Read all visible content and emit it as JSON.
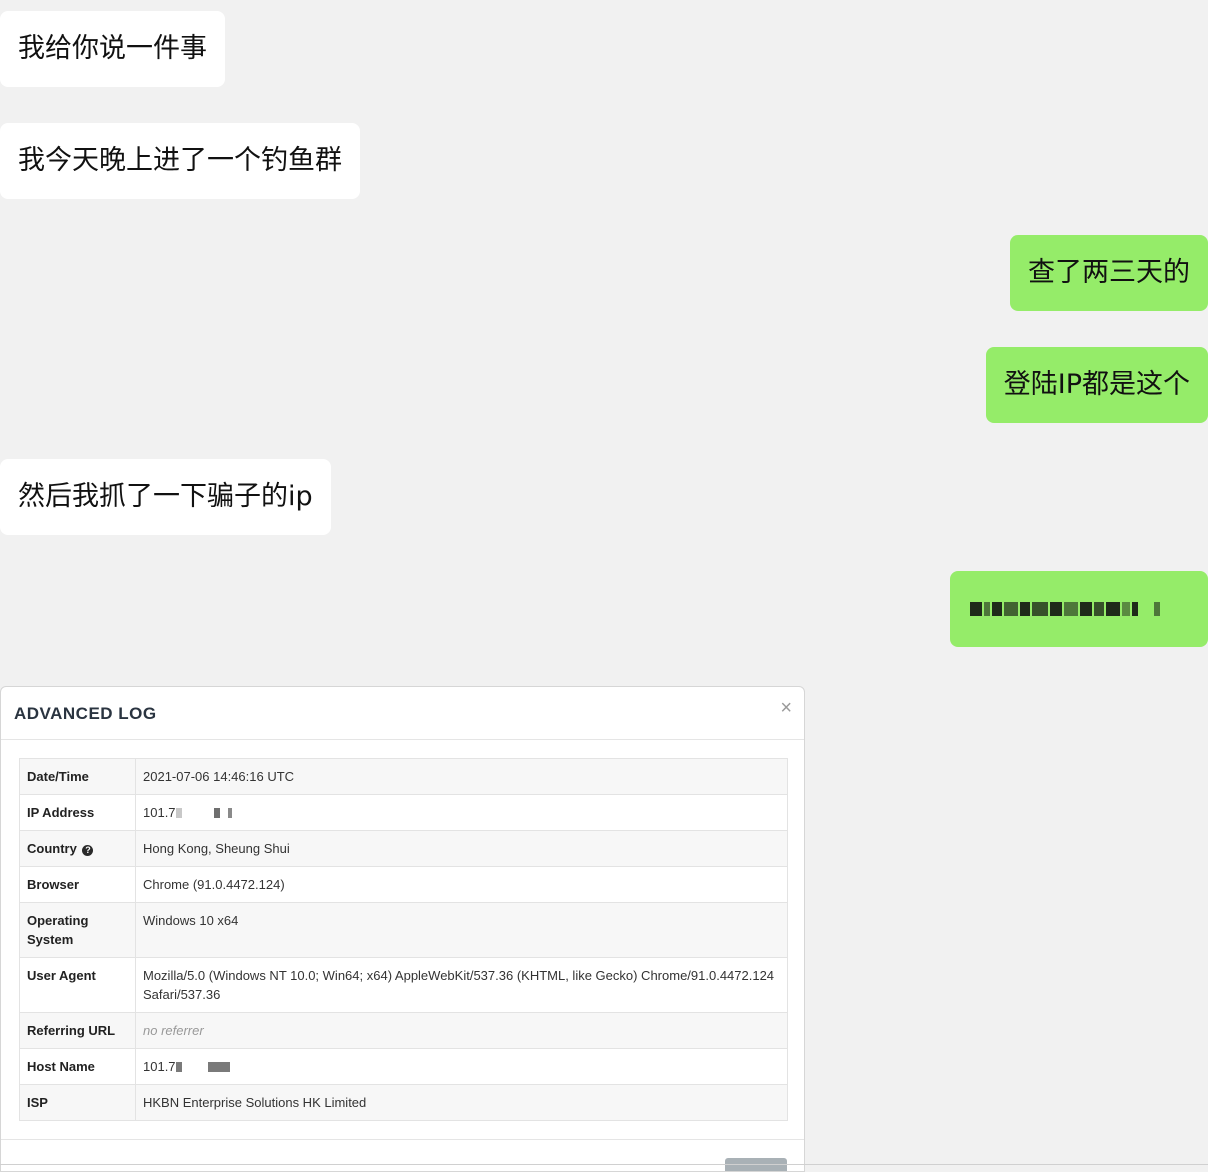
{
  "chat": {
    "messages": [
      {
        "side": "in",
        "text": "我给你说一件事"
      },
      {
        "side": "in",
        "text": "我今天晚上进了一个钓鱼群"
      },
      {
        "side": "out",
        "text": "查了两三天的"
      },
      {
        "side": "out",
        "text": "登陆IP都是这个"
      },
      {
        "side": "in",
        "text": "然后我抓了一下骗子的ip"
      },
      {
        "side": "out",
        "text": "",
        "content": "pixelated-redacted"
      }
    ],
    "colors": {
      "incoming": "#ffffff",
      "outgoing": "#95ec69",
      "background": "#f1f1f1"
    }
  },
  "modal": {
    "title": "ADVANCED LOG",
    "close_symbol": "×",
    "rows": {
      "datetime": {
        "label": "Date/Time",
        "value": "2021-07-06 14:46:16 UTC"
      },
      "ip": {
        "label": "IP Address",
        "value": "101.7"
      },
      "country": {
        "label": "Country",
        "value": "Hong Kong, Sheung Shui",
        "icon": "question-circle-icon"
      },
      "browser": {
        "label": "Browser",
        "value": "Chrome (91.0.4472.124)"
      },
      "os": {
        "label": "Operating System",
        "value": "Windows 10 x64"
      },
      "user_agent": {
        "label": "User Agent",
        "value": "Mozilla/5.0 (Windows NT 10.0; Win64; x64) AppleWebKit/537.36 (KHTML, like Gecko) Chrome/91.0.4472.124 Safari/537.36"
      },
      "referrer": {
        "label": "Referring URL",
        "value": "no referrer"
      },
      "host": {
        "label": "Host Name",
        "value": "101.7"
      },
      "isp": {
        "label": "ISP",
        "value": "HKBN Enterprise Solutions HK Limited"
      }
    }
  }
}
